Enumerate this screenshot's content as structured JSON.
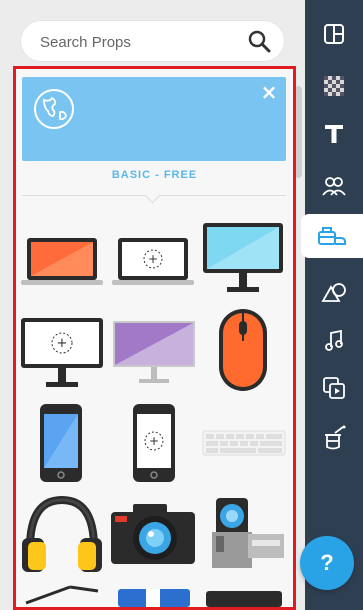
{
  "search": {
    "placeholder": "Search Props"
  },
  "pack": {
    "label": "BASIC - FREE"
  },
  "props": [
    {
      "name": "laptop-orange"
    },
    {
      "name": "laptop-plus"
    },
    {
      "name": "monitor-blue"
    },
    {
      "name": "monitor-plus"
    },
    {
      "name": "monitor-purple"
    },
    {
      "name": "mouse-orange"
    },
    {
      "name": "phone-blue"
    },
    {
      "name": "phone-plus"
    },
    {
      "name": "keyboard"
    },
    {
      "name": "headphones"
    },
    {
      "name": "camera"
    },
    {
      "name": "camcorder"
    }
  ],
  "rail": {
    "items": [
      {
        "name": "layout-icon"
      },
      {
        "name": "background-icon"
      },
      {
        "name": "text-icon"
      },
      {
        "name": "characters-icon"
      },
      {
        "name": "props-icon"
      },
      {
        "name": "shapes-icon"
      },
      {
        "name": "music-icon"
      },
      {
        "name": "video-icon"
      },
      {
        "name": "magic-icon"
      }
    ],
    "help_label": "?"
  },
  "colors": {
    "rail": "#2f3f52",
    "accent": "#2aa3e6",
    "frame": "#e01b22",
    "banner": "#79c4f0"
  }
}
